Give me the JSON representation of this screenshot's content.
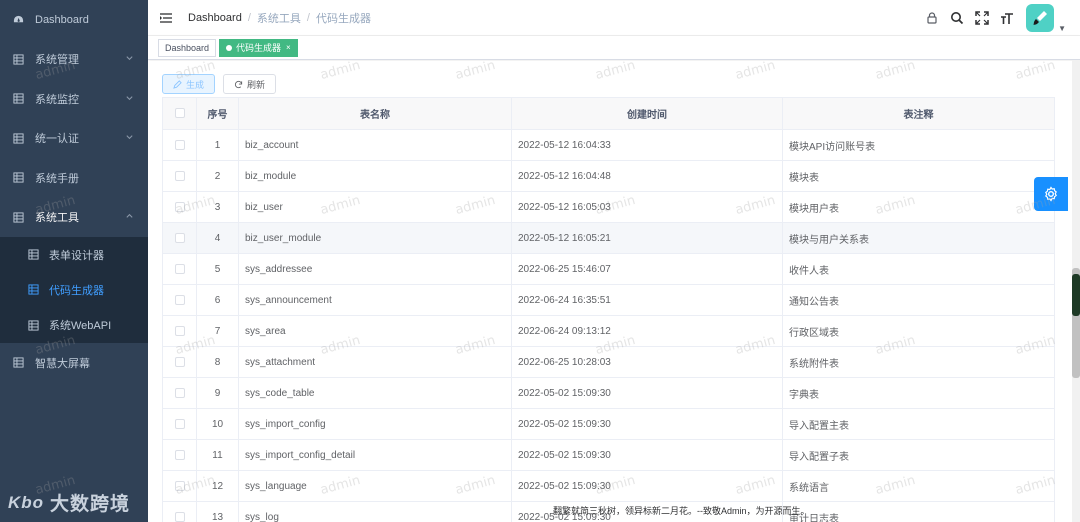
{
  "sidebar": {
    "items": [
      {
        "label": "Dashboard"
      },
      {
        "label": "系统管理"
      },
      {
        "label": "系统监控"
      },
      {
        "label": "统一认证"
      },
      {
        "label": "系统手册"
      },
      {
        "label": "系统工具"
      }
    ],
    "submenu": [
      {
        "label": "表单设计器"
      },
      {
        "label": "代码生成器"
      },
      {
        "label": "系统WebAPI"
      }
    ],
    "last_item": {
      "label": "智慧大屏幕"
    },
    "brand_logo": "Kbo",
    "brand_text": "大数跨境"
  },
  "navbar": {
    "breadcrumb": [
      "Dashboard",
      "系统工具",
      "代码生成器"
    ],
    "separator": "/"
  },
  "tags": [
    {
      "label": "Dashboard"
    },
    {
      "label": "代码生成器",
      "close": "×"
    }
  ],
  "toolbar": {
    "generate_label": "生成",
    "refresh_label": "刷新"
  },
  "table": {
    "columns": [
      "序号",
      "表名称",
      "创建时间",
      "表注释"
    ],
    "rows": [
      {
        "no": "1",
        "name": "biz_account",
        "time": "2022-05-12 16:04:33",
        "comment": "模块API访问账号表"
      },
      {
        "no": "2",
        "name": "biz_module",
        "time": "2022-05-12 16:04:48",
        "comment": "模块表"
      },
      {
        "no": "3",
        "name": "biz_user",
        "time": "2022-05-12 16:05:03",
        "comment": "模块用户表"
      },
      {
        "no": "4",
        "name": "biz_user_module",
        "time": "2022-05-12 16:05:21",
        "comment": "模块与用户关系表"
      },
      {
        "no": "5",
        "name": "sys_addressee",
        "time": "2022-06-25 15:46:07",
        "comment": "收件人表"
      },
      {
        "no": "6",
        "name": "sys_announcement",
        "time": "2022-06-24 16:35:51",
        "comment": "通知公告表"
      },
      {
        "no": "7",
        "name": "sys_area",
        "time": "2022-06-24 09:13:12",
        "comment": "行政区域表"
      },
      {
        "no": "8",
        "name": "sys_attachment",
        "time": "2022-06-25 10:28:03",
        "comment": "系统附件表"
      },
      {
        "no": "9",
        "name": "sys_code_table",
        "time": "2022-05-02 15:09:30",
        "comment": "字典表"
      },
      {
        "no": "10",
        "name": "sys_import_config",
        "time": "2022-05-02 15:09:30",
        "comment": "导入配置主表"
      },
      {
        "no": "11",
        "name": "sys_import_config_detail",
        "time": "2022-05-02 15:09:30",
        "comment": "导入配置子表"
      },
      {
        "no": "12",
        "name": "sys_language",
        "time": "2022-05-02 15:09:30",
        "comment": "系统语言"
      },
      {
        "no": "13",
        "name": "sys_log",
        "time": "2022-05-02 15:09:30",
        "comment": "审计日志表"
      }
    ]
  },
  "watermark": "admin",
  "footer_note": "翻繁就简三秋树，领异标新二月花。--致敬Admin，为开源而生。",
  "colors": {
    "sidebar_bg": "#304156",
    "accent": "#409eff",
    "tag_active": "#42b983",
    "settings": "#1890ff",
    "avatar": "#4fd1c5"
  }
}
